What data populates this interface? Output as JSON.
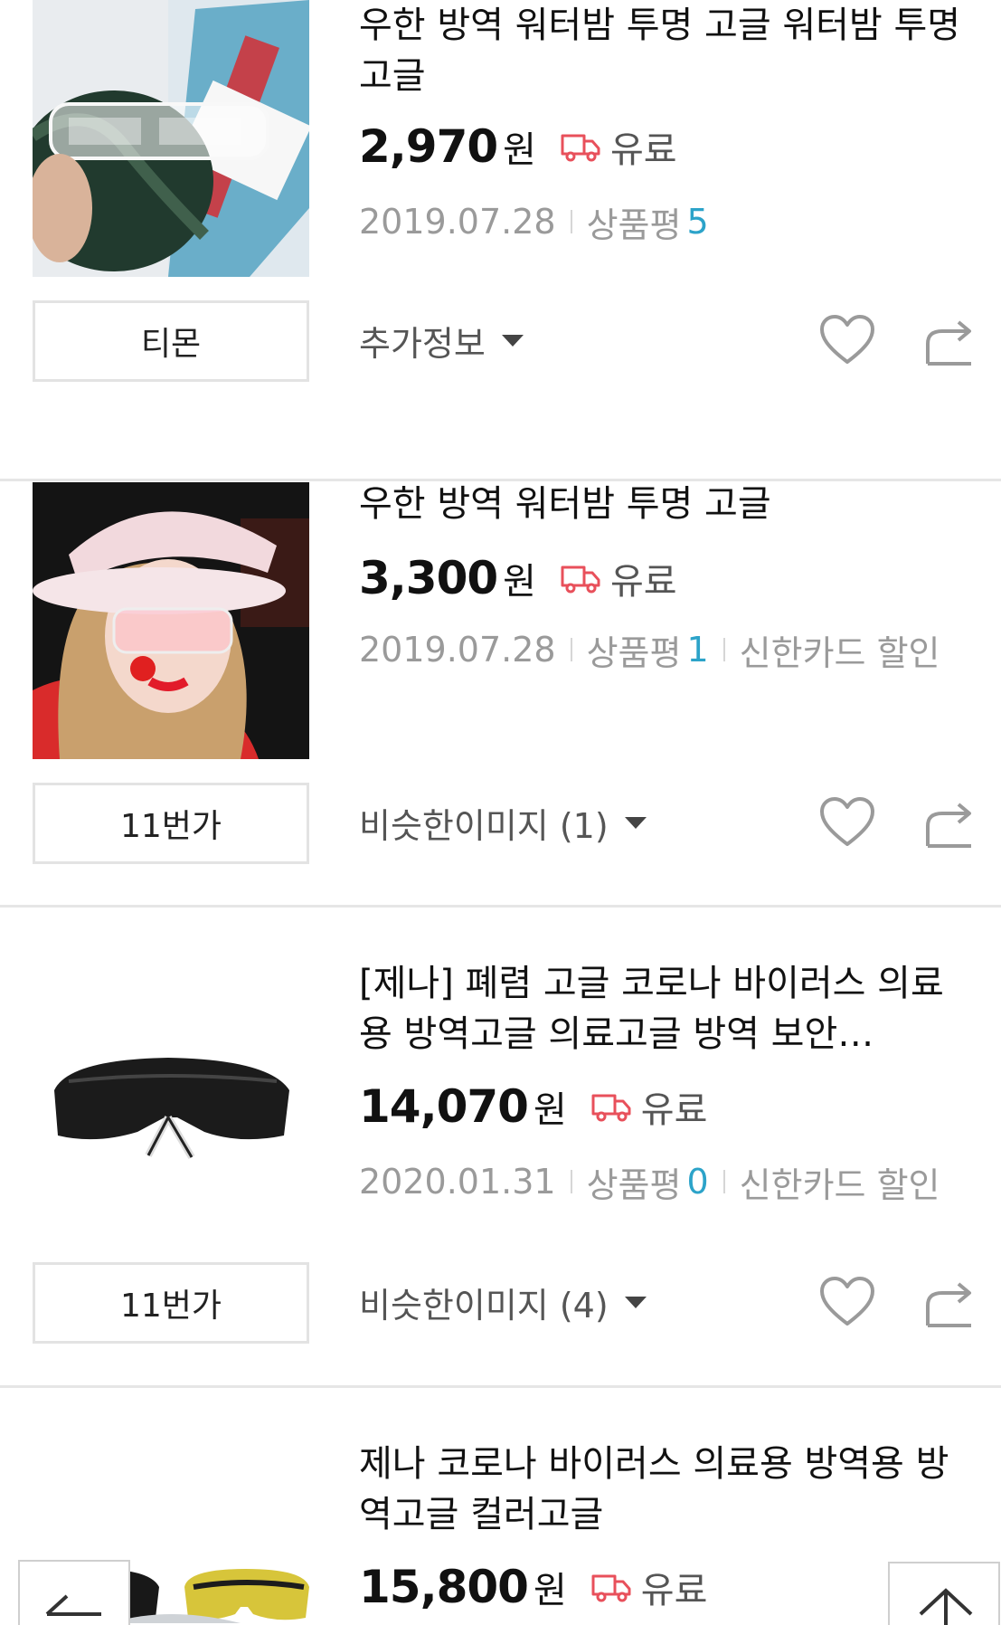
{
  "items": [
    {
      "title": "우한 방역 워터밤 투명 고글 워터밤 투명 고글",
      "price": "2,970",
      "currency": "원",
      "shipping": "유료",
      "date": "2019.07.28",
      "review_label": "상품평",
      "review_count": "5",
      "extra": "",
      "store": "티몬",
      "more_label": "추가정보"
    },
    {
      "title": "우한 방역 워터밤 투명 고글",
      "price": "3,300",
      "currency": "원",
      "shipping": "유료",
      "date": "2019.07.28",
      "review_label": "상품평",
      "review_count": "1",
      "extra": "신한카드 할인",
      "store": "11번가",
      "more_label": "비슷한이미지 (1)"
    },
    {
      "title": "[제나] 폐렴 고글 코로나 바이러스 의료용 방역고글 의료고글 방역 보안…",
      "price": "14,070",
      "currency": "원",
      "shipping": "유료",
      "date": "2020.01.31",
      "review_label": "상품평",
      "review_count": "0",
      "extra": "신한카드 할인",
      "store": "11번가",
      "more_label": "비슷한이미지 (4)"
    },
    {
      "title": "제나 코로나 바이러스 의료용 방역용 방역고글 컬러고글",
      "price": "15,800",
      "currency": "원",
      "shipping": "유료"
    }
  ],
  "colors": {
    "accent_review": "#2ca3c9",
    "truck_icon": "#e8505b"
  },
  "icons": {
    "truck": "delivery-truck-icon",
    "heart": "heart-outline-icon",
    "share": "share-arrow-icon",
    "caret": "caret-down-icon",
    "back": "arrow-left-icon",
    "top": "arrow-up-icon"
  }
}
